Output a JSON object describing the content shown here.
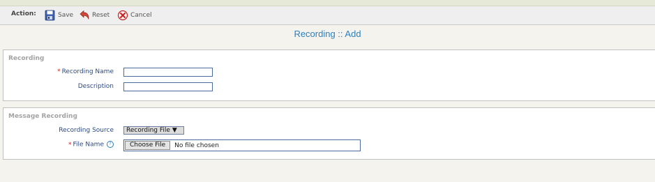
{
  "toolbar": {
    "action_label": "Action:",
    "save_label": "Save",
    "reset_label": "Reset",
    "cancel_label": "Cancel",
    "save_icon": "save-disk-icon",
    "reset_icon": "undo-arrow-icon",
    "cancel_icon": "cancel-x-icon"
  },
  "page": {
    "title": "Recording :: Add"
  },
  "recording_section": {
    "title": "Recording",
    "name_label": "Recording Name",
    "name_value": "",
    "description_label": "Description",
    "description_value": ""
  },
  "message_section": {
    "title": "Message Recording",
    "source_label": "Recording Source",
    "source_selected": "Recording File",
    "file_label": "File Name",
    "file_button_label": "Choose File",
    "file_status": "No file chosen",
    "help_icon": "help-question-icon"
  },
  "colors": {
    "accent": "#2b7fc0",
    "label": "#2c4a86",
    "required": "#cc2222"
  }
}
